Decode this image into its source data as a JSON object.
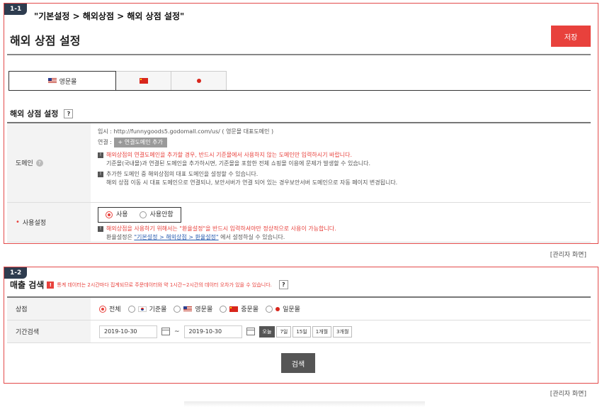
{
  "panel1": {
    "step_badge": "1-1",
    "breadcrumb": "\"기본설정 > 해외상점 > 해외 상점 설정\"",
    "page_title": "해외 상점 설정",
    "save_label": "저장",
    "tabs": [
      {
        "label": "영문몰",
        "flag": "us-flag-icon"
      },
      {
        "label": "",
        "flag": "cn-flag-icon"
      },
      {
        "label": "",
        "flag": "jp-flag-icon"
      }
    ],
    "section_title": "해외 상점 설정",
    "help_label": "?",
    "domain": {
      "label": "도메인",
      "temp_line": "임시 : http://funnygoods5.godomall.com/us/ ( 영문몰 대표도메인 )",
      "connect_label": "연결 :",
      "connect_button": "+ 연결도메인 추가",
      "note1_red": "해외상점의 연결도메인을 추가할 경우, 반드시 기준몰에서 사용하지 않는 도메인만 입력하시기 바랍니다.",
      "note1_sub": "기준몰(국내몰)과 연결된 도메인을 추가하시면, 기준몰을 포함한 전체 쇼핑몰 이용에 문제가 발생할 수 있습니다.",
      "note2_line1": "추가한 도메인 중 해외상점의 대표 도메인을 설정할 수 있습니다.",
      "note2_line2": "해외 상점 이동 시 대표 도메인으로 연결되나, 보안서버가 연결 되어 있는 경우보안서버 도메인으로 자동 페이지 변경됩니다."
    },
    "use": {
      "label": "사용설정",
      "option_use": "사용",
      "option_not_use": "사용안함",
      "note_red": "해외상점을 사용하기 위해서는 \"환율설정\"을 반드시 입력하셔야만 정상적으로 사용이 가능합니다.",
      "note_prefix": "환율설정은 ",
      "note_link": "\"기본설정 > 해외상점 > 환율설정\"",
      "note_suffix": " 에서 설정하실 수 있습니다."
    },
    "caption": "[관리자 화면]"
  },
  "panel2": {
    "step_badge": "1-2",
    "title": "매출 검색",
    "notice_icon": "!",
    "notice": "통계 데이터는 2시간마다 집계되므로 주문데이터와 약 1시간~2시간의 데이터 오차가 있을 수 있습니다.",
    "help_label": "?",
    "store_label": "상점",
    "store_options": [
      {
        "label": "전체",
        "checked": true,
        "flag": ""
      },
      {
        "label": "기준몰",
        "checked": false,
        "flag": "kr-flag-icon"
      },
      {
        "label": "영문몰",
        "checked": false,
        "flag": "us-flag-icon"
      },
      {
        "label": "중문몰",
        "checked": false,
        "flag": "cn-flag-icon"
      },
      {
        "label": "일문몰",
        "checked": false,
        "flag": "jp-flag-icon"
      }
    ],
    "period_label": "기간검색",
    "date_from": "2019-10-30",
    "date_sep": "~",
    "date_to": "2019-10-30",
    "period_buttons": [
      "오늘",
      "7일",
      "15일",
      "1개월",
      "3개월"
    ],
    "active_period": "오늘",
    "search_label": "검색",
    "caption": "[관리자 화면]"
  },
  "colors": {
    "accent": "#e8413c",
    "badge": "#2e3c4f",
    "frame": "#e34a4a"
  }
}
